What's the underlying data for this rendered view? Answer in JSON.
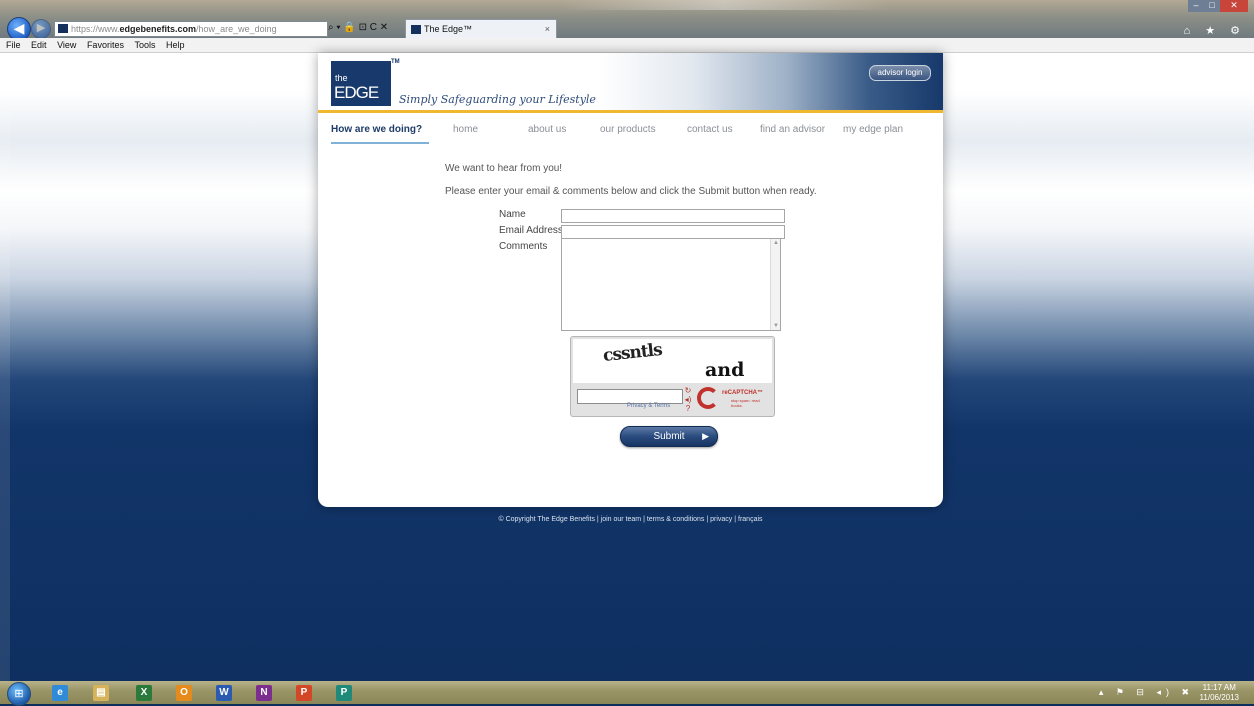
{
  "browser": {
    "address": {
      "prefix": "https://www.",
      "host": "edgebenefits.com",
      "path": "/how_are_we_doing"
    },
    "address_tools": "⌕ ▾ 🔒 ⊡ C ✕",
    "tab_title": "The Edge™",
    "tab_close": "×",
    "back_icon": "back-arrow-icon",
    "forward_icon": "forward-arrow-icon",
    "chrome_icons": "⌂ ★ ⚙",
    "window_controls": {
      "minimize": "–",
      "maximize": "□",
      "close": "✕"
    },
    "menu": [
      "File",
      "Edit",
      "View",
      "Favorites",
      "Tools",
      "Help"
    ]
  },
  "site": {
    "logo": {
      "the": "the",
      "edge": "EDGE",
      "tm": "TM"
    },
    "tagline": "Simply Safeguarding your Lifestyle",
    "advisor_login": "advisor login",
    "nav": [
      {
        "label": "How are we doing?",
        "active": true
      },
      {
        "label": "home"
      },
      {
        "label": "about us"
      },
      {
        "label": "our products"
      },
      {
        "label": "contact us"
      },
      {
        "label": "find an advisor"
      },
      {
        "label": "my edge plan"
      }
    ],
    "accent_color": "#f0b82e",
    "brand_color": "#17396b"
  },
  "form": {
    "intro_heading": "We want to hear from you!",
    "intro_text": "Please enter your email & comments below and click the Submit button when ready.",
    "name_label": "Name",
    "email_label": "Email Address",
    "comments_label": "Comments",
    "name_value": "",
    "email_value": "",
    "comments_value": "",
    "submit_label": "Submit",
    "submit_arrow": "▶"
  },
  "captcha": {
    "word1": "cssntls",
    "word2": "and",
    "privacy_label": "Privacy & Terms",
    "tools": [
      "↻",
      "◂)",
      "?"
    ],
    "brand": "reCAPTCHA™",
    "brand_sub": "stop spam. read books."
  },
  "footer": {
    "text": "© Copyright The Edge Benefits | join our team | terms & conditions | privacy | français"
  },
  "taskbar": {
    "start_icon": "windows-start-icon",
    "apps": [
      {
        "name": "internet-explorer-icon",
        "glyph": "e",
        "color": "#2f8bd8"
      },
      {
        "name": "file-explorer-icon",
        "glyph": "▤",
        "color": "#d6b25a"
      },
      {
        "name": "excel-icon",
        "glyph": "X",
        "color": "#2c7a3b"
      },
      {
        "name": "outlook-icon",
        "glyph": "O",
        "color": "#e58a1c"
      },
      {
        "name": "word-icon",
        "glyph": "W",
        "color": "#2b5bb0"
      },
      {
        "name": "onenote-icon",
        "glyph": "N",
        "color": "#7b2e8e"
      },
      {
        "name": "powerpoint-icon",
        "glyph": "P",
        "color": "#d24726"
      },
      {
        "name": "publisher-icon",
        "glyph": "P",
        "color": "#1f8a7a"
      }
    ],
    "tray": "▴ ⚑ ⊟ ◂) ✖",
    "time": "11:17 AM",
    "date": "11/06/2013"
  }
}
